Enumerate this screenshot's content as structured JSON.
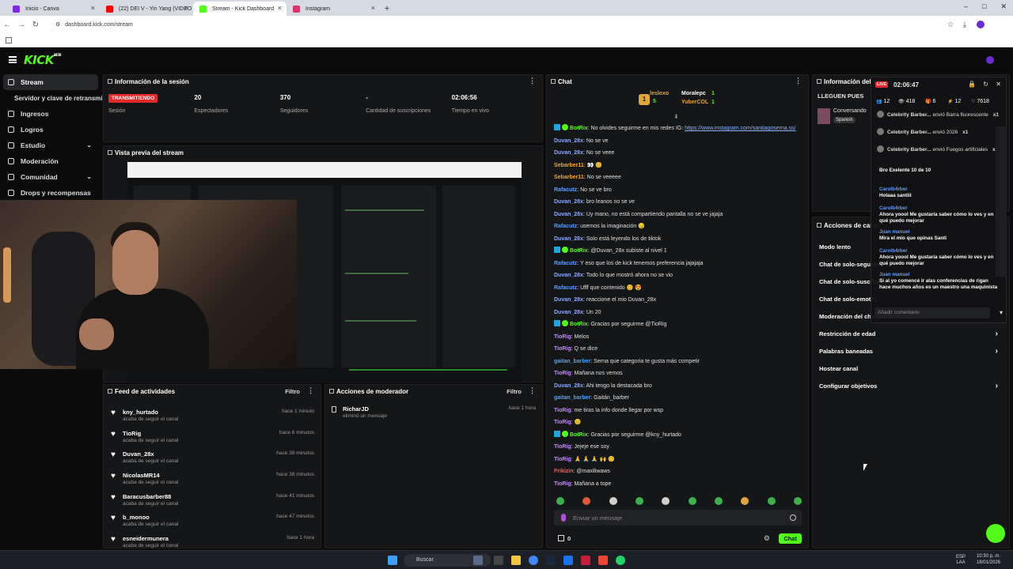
{
  "browser": {
    "tabs": [
      {
        "title": "Inicio - Canva",
        "active": false,
        "color": "#7d2ae8"
      },
      {
        "title": "(22) DEI V - Yin Yang (VIDEO OF",
        "active": false,
        "color": "#ff0000"
      },
      {
        "title": "Stream - Kick Dashboard",
        "active": true,
        "color": "#53fc18"
      },
      {
        "title": "Instagram",
        "active": false,
        "color": "#e1306c"
      }
    ],
    "url": "dashboard.kick.com/stream"
  },
  "kick": {
    "logo": "KICK",
    "logo_sup": "BETA",
    "accent": "#53fc18"
  },
  "sidebar": {
    "items": [
      {
        "label": "Stream",
        "active": true,
        "chevron": false
      },
      {
        "label": "Servidor y clave de retransmisión",
        "sub": true
      },
      {
        "label": "Ingresos",
        "chevron": false
      },
      {
        "label": "Logros",
        "chevron": false
      },
      {
        "label": "Estudio",
        "chevron": true
      },
      {
        "label": "Moderación",
        "chevron": false
      },
      {
        "label": "Comunidad",
        "chevron": true
      },
      {
        "label": "Drops y recompensas",
        "chevron": false
      }
    ]
  },
  "session": {
    "title": "Información de la sesión",
    "status_badge": "TRANSMITIENDO",
    "status_label": "Sesión",
    "stats": [
      {
        "value": "20",
        "label": "Espectadores"
      },
      {
        "value": "370",
        "label": "Seguidores"
      },
      {
        "value": "-",
        "label": "Cantidad de suscripciones"
      },
      {
        "value": "02:06:56",
        "label": "Tiempo en vivo"
      }
    ]
  },
  "preview": {
    "title": "Vista previa del stream"
  },
  "feed": {
    "title": "Feed de actividades",
    "filter": "Filtro",
    "items": [
      {
        "name": "kny_hurtado",
        "action": "acaba de seguir el canal",
        "time": "hace 1 minuto"
      },
      {
        "name": "TioRig",
        "action": "acaba de seguir el canal",
        "time": "hace 6 minutos"
      },
      {
        "name": "Duvan_28x",
        "action": "acaba de seguir el canal",
        "time": "hace 38 minutos"
      },
      {
        "name": "NicolasMR14",
        "action": "acaba de seguir el canal",
        "time": "hace 38 minutos"
      },
      {
        "name": "Baracusbarber88",
        "action": "acaba de seguir el canal",
        "time": "hace 41 minutos"
      },
      {
        "name": "b_monoo",
        "action": "acaba de seguir el canal",
        "time": "hace 47 minutos"
      },
      {
        "name": "esneidermunera",
        "action": "acaba de seguir el canal",
        "time": "hace 1 hora"
      }
    ]
  },
  "mod": {
    "title": "Acciones de moderador",
    "filter": "Filtro",
    "items": [
      {
        "name": "RicharJD",
        "action": "eliminó un mensaje",
        "time": "hace 1 hora"
      }
    ]
  },
  "chat": {
    "title": "Chat",
    "pinned": [
      {
        "name": "lesloxo",
        "count": "5"
      },
      {
        "name": "Moralepc",
        "count": "1"
      },
      {
        "name": "YuberCOL",
        "count": "1"
      }
    ],
    "messages": [
      {
        "user": "BotRix",
        "text": ": No olvides seguirme en mis redes IG: ",
        "link": "https://www.instagram.com/santiagoserna.ss/",
        "color": "#53fc18",
        "bot": true
      },
      {
        "user": "Duvan_28x",
        "text": ": No se ve",
        "color": "#8fa8ff"
      },
      {
        "user": "Duvan_28x",
        "text": ": No se veee",
        "color": "#8fa8ff"
      },
      {
        "user": "Sebarber11",
        "text": ": 👀 😊",
        "color": "#f5a623"
      },
      {
        "user": "Sebarber11",
        "text": ": No se veeeee",
        "color": "#f5a623"
      },
      {
        "user": "Rafacutz",
        "text": ": No se ve bro",
        "color": "#5d9dff"
      },
      {
        "user": "Duvan_28x",
        "text": ": bro leanos no se ve",
        "color": "#8fa8ff"
      },
      {
        "user": "Duvan_28x",
        "text": ": Uy mano, no está compartiendo pantalla no se ve jajaja",
        "color": "#8fa8ff"
      },
      {
        "user": "Rafacutz",
        "text": ": usemos la imaginación 😏",
        "color": "#5d9dff"
      },
      {
        "user": "Duvan_28x",
        "text": ": Solo está leyendo los de tiktok",
        "color": "#8fa8ff"
      },
      {
        "user": "BotRix",
        "text": ": @Duvan_28x subiste al nivel 1",
        "color": "#53fc18",
        "bot": true
      },
      {
        "user": "Rafacutz",
        "text": ": Y eso que los de kick tenemos preferencia jajajaja",
        "color": "#5d9dff"
      },
      {
        "user": "Duvan_28x",
        "text": ": Todo lo que mostró ahora no se vio",
        "color": "#8fa8ff"
      },
      {
        "user": "Rafacutz",
        "text": ": Ufff que contenido 😊 😍",
        "color": "#5d9dff"
      },
      {
        "user": "Duvan_28x",
        "text": ": reaccione el mio Duvan_28x",
        "color": "#8fa8ff"
      },
      {
        "user": "Duvan_28x",
        "text": ": Un 20",
        "color": "#8fa8ff"
      },
      {
        "user": "BotRix",
        "text": ": Gracias por seguirme @TioRig",
        "color": "#53fc18",
        "bot": true
      },
      {
        "user": "TioRig",
        "text": ": Melos",
        "color": "#c58cff"
      },
      {
        "user": "TioRig",
        "text": ": Q se dice",
        "color": "#c58cff"
      },
      {
        "user": "gaitan_barber",
        "text": ": Serna que categoria te gusta más competir",
        "color": "#4aa3ff"
      },
      {
        "user": "TioRig",
        "text": ": Mañana nos vemos",
        "color": "#c58cff"
      },
      {
        "user": "Duvan_28x",
        "text": ": Ahi tengo la destacada bro",
        "color": "#8fa8ff"
      },
      {
        "user": "gaitan_barber",
        "text": ": Gaitán_barber",
        "color": "#4aa3ff"
      },
      {
        "user": "TioRig",
        "text": ": me tiras la info donde llegar por wsp",
        "color": "#c58cff"
      },
      {
        "user": "TioRig",
        "text": ": 😊",
        "color": "#c58cff"
      },
      {
        "user": "BotRix",
        "text": ": Gracias por seguirme @kny_hurtado",
        "color": "#53fc18",
        "bot": true
      },
      {
        "user": "TioRig",
        "text": ": Jejeje ese soy",
        "color": "#c58cff"
      },
      {
        "user": "TioRig",
        "text": ": 🙏 🙏 🙏 🙌 😊",
        "color": "#c58cff"
      },
      {
        "user": "Frikizin",
        "text": ": @maxiliwaws",
        "color": "#ff5c5c"
      },
      {
        "user": "TioRig",
        "text": ": Mañana a tope",
        "color": "#c58cff"
      }
    ],
    "input_placeholder": "Enviar un mensaje",
    "points": "0",
    "send_label": "Chat"
  },
  "channel_info": {
    "title": "Información del stream",
    "stream_title": "LLEGUEN PUES",
    "category": "Conversando",
    "language": "Spanish"
  },
  "channel_actions": {
    "title": "Acciones de canal",
    "rows": [
      {
        "label": "Modo lento",
        "arrow": false
      },
      {
        "label": "Chat de solo-seguidores",
        "arrow": false
      },
      {
        "label": "Chat de solo-suscriptores",
        "arrow": false
      },
      {
        "label": "Chat de solo-emotes",
        "arrow": false
      },
      {
        "label": "Moderación del chat",
        "arrow": false
      },
      {
        "label": "Restricción de edad",
        "arrow": true
      },
      {
        "label": "Palabras baneadas",
        "arrow": true
      },
      {
        "label": "Hostear canal",
        "arrow": false
      },
      {
        "label": "Configurar objetivos",
        "arrow": true
      }
    ]
  },
  "overlay": {
    "live": "LIVE",
    "time": "02:06:47",
    "stats": [
      "12",
      "418",
      "6",
      "12",
      "7618"
    ],
    "events": [
      {
        "name": "Celebrity Barber...",
        "text": "envió Barra fluorescente",
        "mult": "x1"
      },
      {
        "name": "Celebrity Barber...",
        "text": "envió 2026",
        "mult": "x1"
      },
      {
        "name": "Celebrity Barber...",
        "text": "envió Fuegos artificiales",
        "mult": "x1"
      }
    ],
    "messages": [
      {
        "user": "",
        "text": "Bro Exelente 10 de 10"
      },
      {
        "user": "Carolb4rber",
        "text": "Holaaa santiii"
      },
      {
        "user": "Carolb4rber",
        "text": "Ahora yoool Me gustaría saber cómo lo ves y en qué puedo mejorar"
      },
      {
        "user": "Juan manuel",
        "text": "Mira el mío que opinas Santi"
      },
      {
        "user": "Carolb4rber",
        "text": "Ahora yoool Me gustaría saber cómo lo ves y en qué puedo mejorar"
      },
      {
        "user": "Juan manuel",
        "text": "Si al yo comencé ir alas conferencias de rigan hace muchos años es un maestro una maquinista"
      }
    ],
    "input_placeholder": "Añadir comentario"
  },
  "taskbar": {
    "search": "Buscar",
    "lang": "ESP",
    "lang2": "LAA",
    "time": "10:30 p. m.",
    "date": "18/01/2026"
  }
}
